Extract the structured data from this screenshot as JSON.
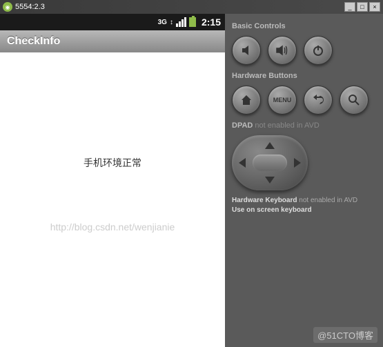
{
  "titlebar": {
    "title": "5554:2.3"
  },
  "winbuttons": {
    "min": "_",
    "max": "□",
    "close": "×"
  },
  "statusbar": {
    "net": "3G",
    "time": "2:15"
  },
  "appbar": {
    "title": "CheckInfo"
  },
  "content": {
    "message": "手机环境正常",
    "watermark": "http://blog.csdn.net/wenjianie"
  },
  "controls": {
    "basic_label": "Basic Controls",
    "hardware_label": "Hardware Buttons",
    "menu_label": "MENU",
    "dpad_label": "DPAD",
    "dpad_note": "not enabled in AVD",
    "keyboard_label": "Hardware Keyboard",
    "keyboard_note": "not enabled in AVD",
    "keyboard_hint": "Use on screen keyboard"
  },
  "brand": "@51CTO博客"
}
